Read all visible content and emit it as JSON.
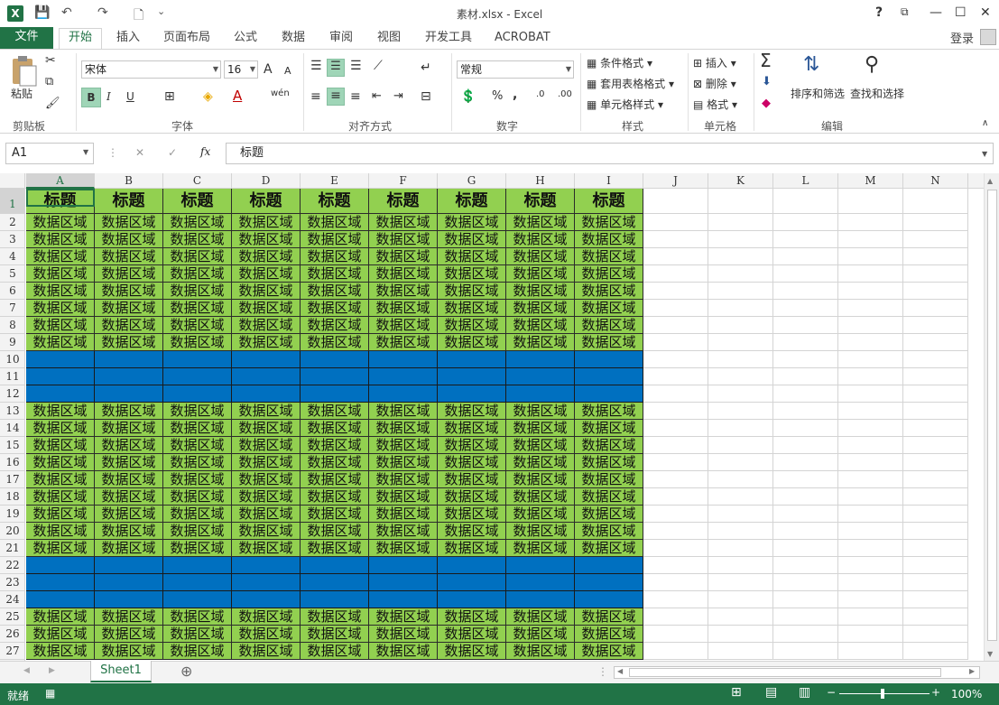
{
  "window": {
    "title": "素材.xlsx - Excel",
    "help": "?",
    "minimize": "—",
    "restore": "☐",
    "close": "✕",
    "ribbon_display": "⧉"
  },
  "qat": {
    "save": "💾",
    "undo": "↶",
    "redo": "↷",
    "preview": "🗋",
    "customize": "⌄"
  },
  "tabs": {
    "file": "文件",
    "items": [
      "开始",
      "插入",
      "页面布局",
      "公式",
      "数据",
      "审阅",
      "视图",
      "开发工具",
      "ACROBAT"
    ],
    "active": "开始",
    "login": "登录"
  },
  "ribbon": {
    "clipboard": {
      "paste": "粘贴",
      "label": "剪贴板"
    },
    "font": {
      "name": "宋体",
      "size": "16",
      "bold": "B",
      "italic": "I",
      "underline": "U",
      "label": "字体",
      "grow": "A",
      "shrink": "A",
      "phonetic": "wén"
    },
    "alignment": {
      "label": "对齐方式"
    },
    "number": {
      "format": "常规",
      "percent": "%",
      "comma": ",",
      "label": "数字"
    },
    "styles": {
      "conditional": "条件格式",
      "table": "套用表格格式",
      "cell": "单元格样式",
      "label": "样式"
    },
    "cells": {
      "insert": "插入",
      "delete": "删除",
      "format": "格式",
      "label": "单元格"
    },
    "editing": {
      "sort": "排序和筛选",
      "find": "查找和选择",
      "label": "编辑",
      "sum": "Σ"
    }
  },
  "formula_bar": {
    "name_box": "A1",
    "cancel": "✕",
    "enter": "✓",
    "fx": "fx",
    "value": "标题"
  },
  "sheet": {
    "columns": [
      "A",
      "B",
      "C",
      "D",
      "E",
      "F",
      "G",
      "H",
      "I",
      "J",
      "K",
      "L",
      "M",
      "N"
    ],
    "rows": [
      "1",
      "2",
      "3",
      "4",
      "5",
      "6",
      "7",
      "8",
      "9",
      "10",
      "11",
      "12",
      "13",
      "14",
      "15",
      "16",
      "17",
      "18",
      "19",
      "20",
      "21",
      "22",
      "23",
      "24",
      "25",
      "26",
      "27"
    ],
    "header_text": "标题",
    "data_text": "数据区域",
    "blue_rows": [
      10,
      11,
      12,
      22,
      23,
      24
    ],
    "selected_cell": "A1",
    "colors": {
      "green": "#92d050",
      "blue": "#0070c0",
      "accent": "#217346"
    }
  },
  "sheet_tabs": {
    "active": "Sheet1",
    "add": "⊕",
    "prev": "◀",
    "next": "▶"
  },
  "status": {
    "ready": "就绪",
    "zoom": "100%",
    "zoom_minus": "−",
    "zoom_plus": "+"
  }
}
